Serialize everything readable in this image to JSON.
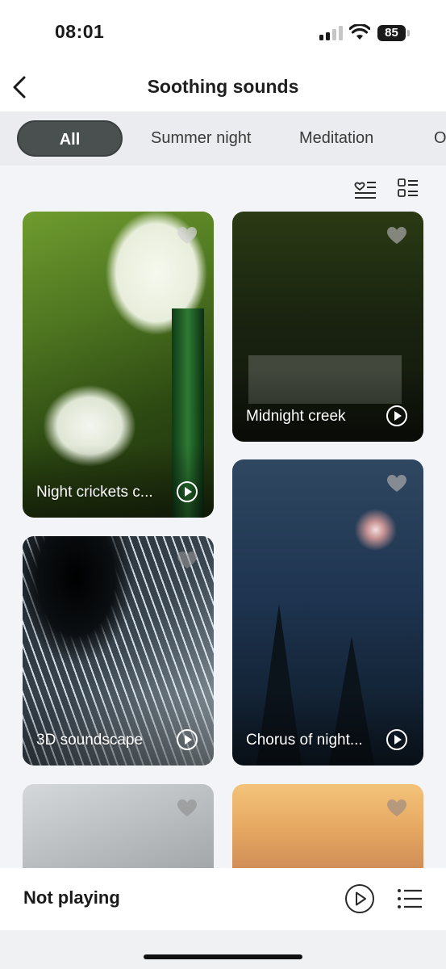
{
  "status_bar": {
    "time": "08:01",
    "battery": "85"
  },
  "header": {
    "title": "Soothing sounds",
    "back_icon": "chevron-left-icon"
  },
  "tabs": [
    {
      "label": "All",
      "active": true
    },
    {
      "label": "Summer night",
      "active": false
    },
    {
      "label": "Meditation",
      "active": false
    },
    {
      "label": "O",
      "active": false
    }
  ],
  "view_toggles": {
    "favorites_icon": "heart-list-icon",
    "grid_icon": "grid-list-icon"
  },
  "cards": [
    {
      "title": "Night crickets c...",
      "favorited": false
    },
    {
      "title": "Midnight creek",
      "favorited": false
    },
    {
      "title": "3D soundscape",
      "favorited": false
    },
    {
      "title": "Chorus of night...",
      "favorited": false
    },
    {
      "title": "",
      "favorited": false
    },
    {
      "title": "",
      "favorited": false
    }
  ],
  "player": {
    "status": "Not playing",
    "play_icon": "play-circle-icon",
    "playlist_icon": "playlist-icon"
  },
  "colors": {
    "tab_active_bg": "#4a5050",
    "tabs_bg": "#ebecef",
    "page_bg": "#f3f4f7"
  }
}
